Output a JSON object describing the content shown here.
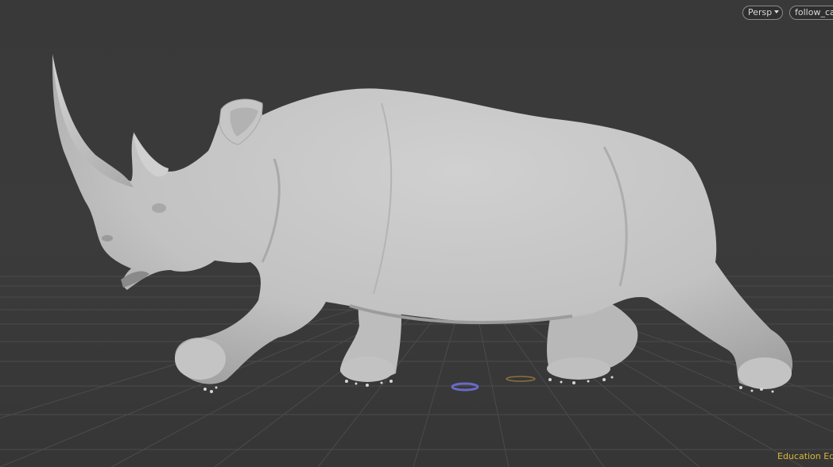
{
  "viewport": {
    "camera_menu": {
      "label": "Persp",
      "icon": "chevron-down-icon"
    },
    "camera_name": {
      "label": "follow_ca"
    },
    "edition_badge": "Education Edi",
    "colors": {
      "background": "#3a3a3a",
      "grid": "#4a4a4a",
      "model": "#c9c9c9",
      "edition_text": "#d8b63a",
      "origin_marker": "#6a6ac8"
    }
  }
}
